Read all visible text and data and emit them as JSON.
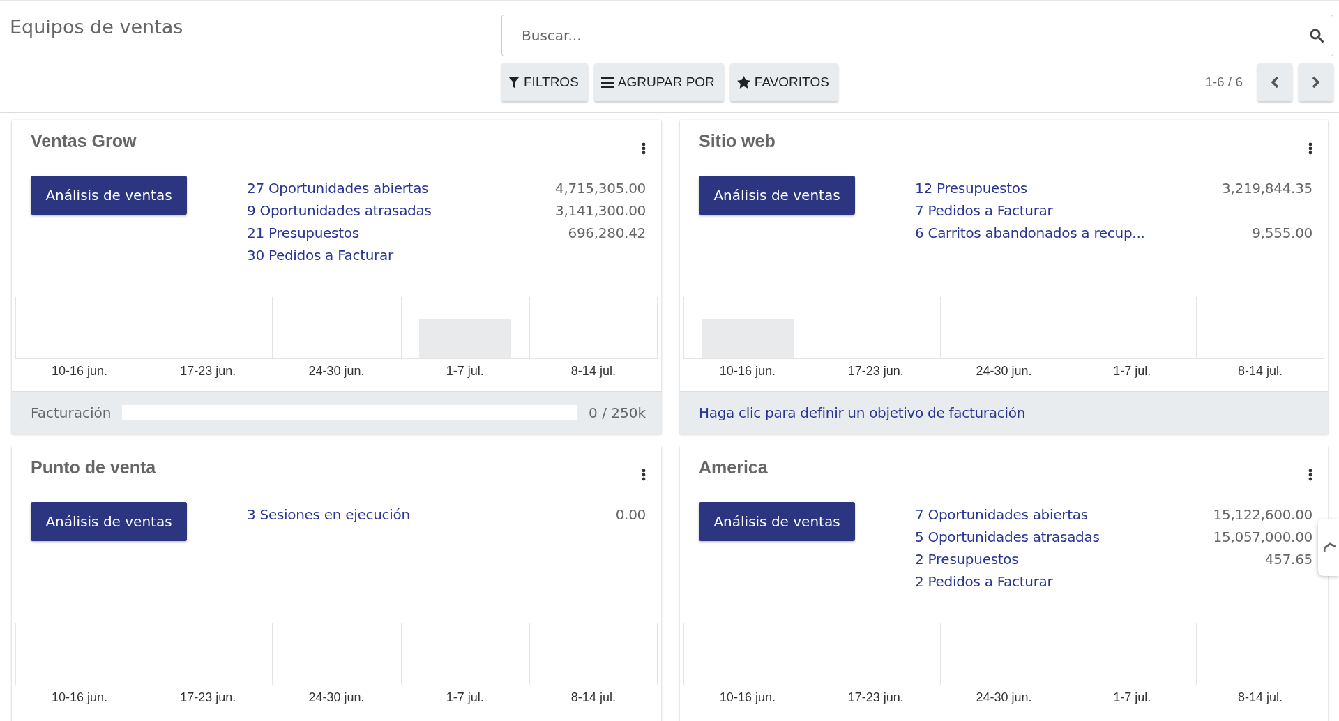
{
  "page_title": "Equipos de ventas",
  "search": {
    "placeholder": "Buscar..."
  },
  "toolbar": [
    {
      "kind": "filter",
      "label": "FILTROS"
    },
    {
      "kind": "group",
      "label": "AGRUPAR POR"
    },
    {
      "kind": "star",
      "label": "FAVORITOS"
    }
  ],
  "pager": "1-6 / 6",
  "teams": [
    {
      "name": "Ventas Grow",
      "button": "Análisis de ventas",
      "stats": [
        {
          "label": "27 Oportunidades abiertas",
          "value": "4,715,305.00"
        },
        {
          "label": "9 Oportunidades atrasadas",
          "value": "3,141,300.00"
        },
        {
          "label": "21 Presupuestos",
          "value": "696,280.42"
        },
        {
          "label": "30 Pedidos a Facturar"
        }
      ],
      "weeks": [
        {
          "label": "10-16 jun.",
          "bar": false
        },
        {
          "label": "17-23 jun.",
          "bar": false
        },
        {
          "label": "24-30 jun.",
          "bar": false
        },
        {
          "label": "1-7 jul.",
          "bar": true
        },
        {
          "label": "8-14 jul.",
          "bar": false
        }
      ],
      "footer": {
        "kind": "progress",
        "label": "Facturación",
        "level": 0,
        "reading": "0 / 250k"
      }
    },
    {
      "name": "Sitio web",
      "button": "Análisis de ventas",
      "stats": [
        {
          "label": "12 Presupuestos",
          "value": "3,219,844.35"
        },
        {
          "label": "7 Pedidos a Facturar"
        },
        {
          "label": "6 Carritos abandonados a recup...",
          "value": "9,555.00"
        }
      ],
      "weeks": [
        {
          "label": "10-16 jun.",
          "bar": true
        },
        {
          "label": "17-23 jun.",
          "bar": false
        },
        {
          "label": "24-30 jun.",
          "bar": false
        },
        {
          "label": "1-7 jul.",
          "bar": false
        },
        {
          "label": "8-14 jul.",
          "bar": false
        }
      ],
      "footer": {
        "kind": "link",
        "text": "Haga clic para definir un objetivo de facturación"
      }
    },
    {
      "name": "Punto de venta",
      "button": "Análisis de ventas",
      "stats": [
        {
          "label": "3 Sesiones en ejecución",
          "value": "0.00"
        }
      ],
      "weeks": [
        {
          "label": "10-16 jun.",
          "bar": false
        },
        {
          "label": "17-23 jun.",
          "bar": false
        },
        {
          "label": "24-30 jun.",
          "bar": false
        },
        {
          "label": "1-7 jul.",
          "bar": false
        },
        {
          "label": "8-14 jul.",
          "bar": false
        }
      ]
    },
    {
      "name": "America",
      "button": "Análisis de ventas",
      "stats": [
        {
          "label": "7 Oportunidades abiertas",
          "value": "15,122,600.00"
        },
        {
          "label": "5 Oportunidades atrasadas",
          "value": "15,057,000.00"
        },
        {
          "label": "2 Presupuestos",
          "value": "457.65"
        },
        {
          "label": "2 Pedidos a Facturar"
        }
      ],
      "weeks": [
        {
          "label": "10-16 jun.",
          "bar": false
        },
        {
          "label": "17-23 jun.",
          "bar": false
        },
        {
          "label": "24-30 jun.",
          "bar": false
        },
        {
          "label": "1-7 jul.",
          "bar": false
        },
        {
          "label": "8-14 jul.",
          "bar": false
        }
      ]
    }
  ]
}
